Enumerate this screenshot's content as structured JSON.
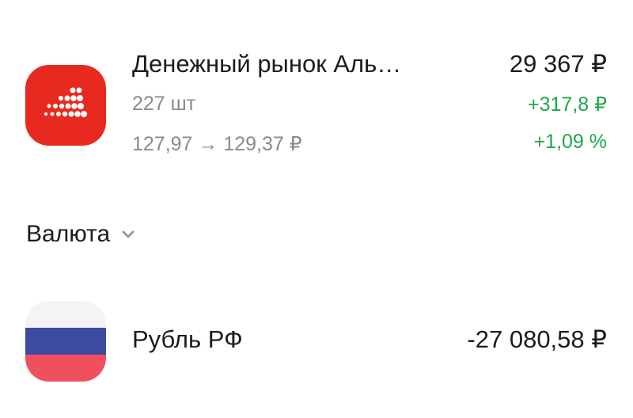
{
  "holding": {
    "name": "Денежный рынок Аль…",
    "quantity": "227 шт",
    "price_change": "127,97 → 129,37 ₽",
    "value": "29 367 ₽",
    "gain_abs": "+317,8 ₽",
    "gain_pct": "+1,09 %",
    "icon": "fund-logo-dots-icon",
    "icon_color": "#e8291f",
    "gain_color": "#1ea84a"
  },
  "section": {
    "title": "Валюта",
    "chevron_icon": "chevron-down-icon"
  },
  "currency": {
    "name": "Рубль РФ",
    "value": "-27 080,58 ₽",
    "icon": "russian-flag-icon",
    "flag_colors": [
      "#f4f4f6",
      "#3d4ba3",
      "#f0505e"
    ]
  }
}
